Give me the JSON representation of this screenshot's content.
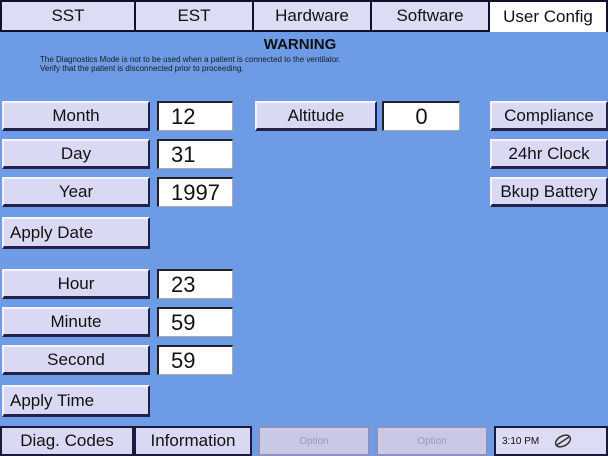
{
  "tabs": [
    {
      "label": "SST",
      "active": false
    },
    {
      "label": "EST",
      "active": false
    },
    {
      "label": "Hardware",
      "active": false
    },
    {
      "label": "Software",
      "active": false
    },
    {
      "label": "User Config",
      "active": true
    }
  ],
  "warning": {
    "title": "WARNING",
    "line1": "The Diagnostics Mode is not to be used when a patient is connected to the ventilator.",
    "line2": "Verify that the patient is disconnected prior to proceeding."
  },
  "date": {
    "month_label": "Month",
    "month_value": "12",
    "day_label": "Day",
    "day_value": "31",
    "year_label": "Year",
    "year_value": "1997",
    "apply_label": "Apply Date"
  },
  "altitude": {
    "label": "Altitude",
    "value": "0"
  },
  "right_buttons": {
    "compliance": "Compliance",
    "clock24": "24hr Clock",
    "battery": "Bkup Battery"
  },
  "time": {
    "hour_label": "Hour",
    "hour_value": "23",
    "minute_label": "Minute",
    "minute_value": "59",
    "second_label": "Second",
    "second_value": "59",
    "apply_label": "Apply Time"
  },
  "bottom_bar": {
    "diag_codes": "Diag. Codes",
    "information": "Information",
    "option1": "Option",
    "option2": "Option",
    "clock": "3:10 PM"
  },
  "colors": {
    "background": "#6d9be6",
    "button": "#d9d9f3",
    "border": "#10102a"
  }
}
